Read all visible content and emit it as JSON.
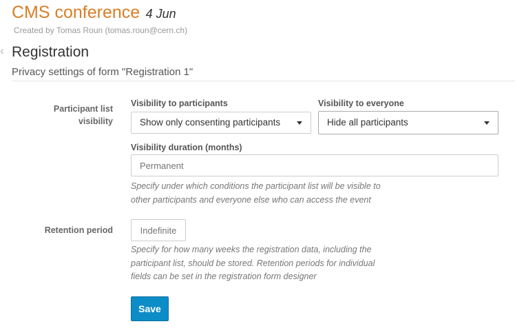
{
  "event": {
    "name": "CMS conference",
    "date": "4 Jun",
    "created_by": "Created by Tomas Roun (tomas.roun@cern.ch)"
  },
  "page": {
    "title": "Registration",
    "subtitle": "Privacy settings of form \"Registration 1\""
  },
  "participant_list": {
    "label_line1": "Participant list",
    "label_line2": "visibility",
    "visibility_participants": {
      "label": "Visibility to participants",
      "value": "Show only consenting participants"
    },
    "visibility_everyone": {
      "label": "Visibility to everyone",
      "value": "Hide all participants"
    },
    "duration": {
      "label": "Visibility duration (months)",
      "placeholder": "Permanent",
      "value": ""
    },
    "help_line1": "Specify under which conditions the participant list will be visible to",
    "help_line2": "other participants and everyone else who can access the event"
  },
  "retention": {
    "label": "Retention period",
    "placeholder": "Indefinite",
    "help_line1": "Specify for how many weeks the registration data, including the",
    "help_line2": "participant list, should be stored. Retention periods for individual",
    "help_line3": "fields can be set in the registration form designer"
  },
  "actions": {
    "save_label": "Save"
  }
}
